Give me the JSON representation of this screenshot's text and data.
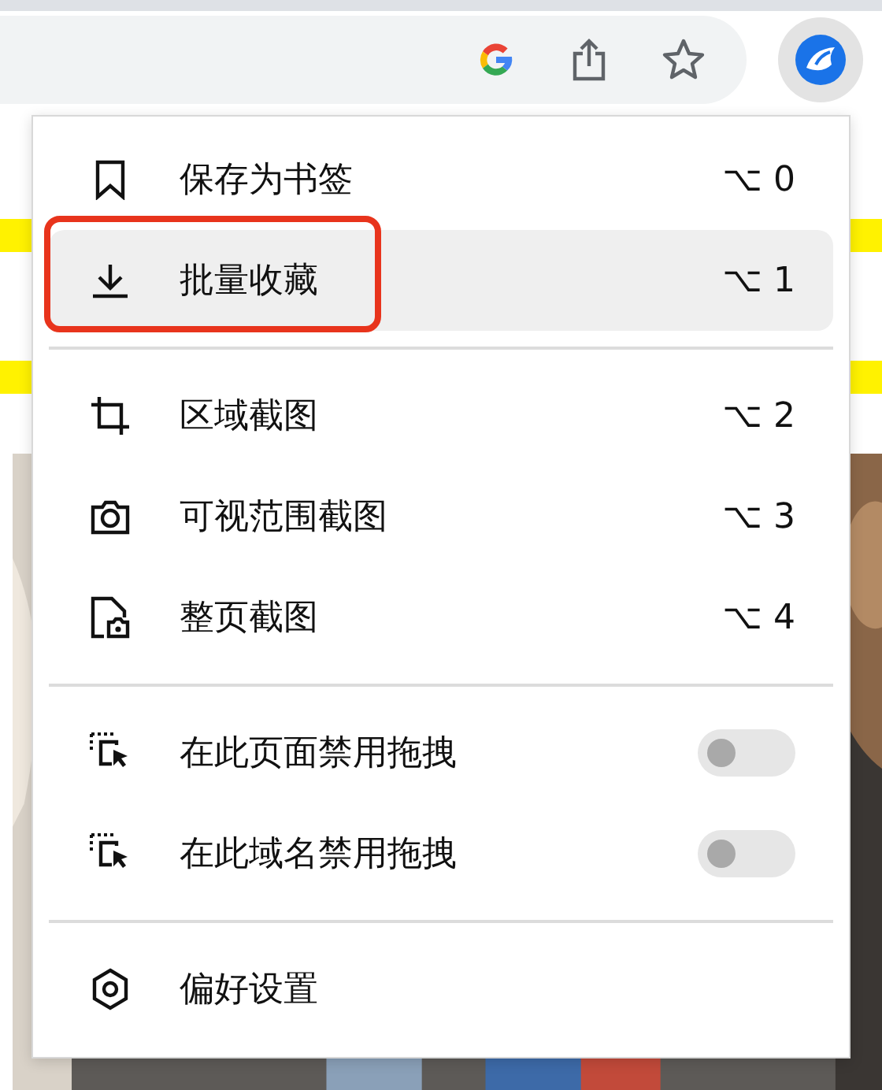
{
  "menu": {
    "groups": [
      {
        "items": [
          {
            "kind": "shortcut",
            "label": "保存为书签",
            "shortcut": "⌥ 0",
            "selected": false,
            "outlined": false
          },
          {
            "kind": "shortcut",
            "label": "批量收藏",
            "shortcut": "⌥ 1",
            "selected": true,
            "outlined": true
          }
        ]
      },
      {
        "items": [
          {
            "kind": "shortcut",
            "label": "区域截图",
            "shortcut": "⌥ 2",
            "selected": false,
            "outlined": false
          },
          {
            "kind": "shortcut",
            "label": "可视范围截图",
            "shortcut": "⌥ 3",
            "selected": false,
            "outlined": false
          },
          {
            "kind": "shortcut",
            "label": "整页截图",
            "shortcut": "⌥ 4",
            "selected": false,
            "outlined": false
          }
        ]
      },
      {
        "items": [
          {
            "kind": "toggle",
            "label": "在此页面禁用拖拽",
            "on": false,
            "selected": false,
            "outlined": false
          },
          {
            "kind": "toggle",
            "label": "在此域名禁用拖拽",
            "on": false,
            "selected": false,
            "outlined": false
          }
        ]
      },
      {
        "items": [
          {
            "kind": "plain",
            "label": "偏好设置",
            "selected": false,
            "outlined": false
          }
        ]
      }
    ]
  }
}
